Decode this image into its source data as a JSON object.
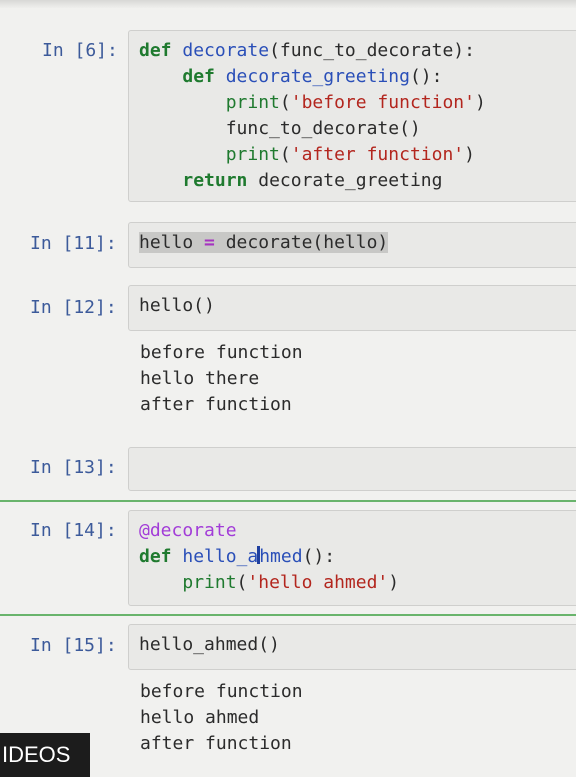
{
  "cells": [
    {
      "prompt": "In [6]:",
      "lines": [
        {
          "tokens": [
            {
              "t": "def",
              "c": "kw"
            },
            {
              "t": " ",
              "c": "txt"
            },
            {
              "t": "decorate",
              "c": "fn"
            },
            {
              "t": "(func_to_decorate):",
              "c": "txt"
            }
          ]
        },
        {
          "tokens": [
            {
              "t": "    ",
              "c": "txt"
            },
            {
              "t": "def",
              "c": "kw"
            },
            {
              "t": " ",
              "c": "txt"
            },
            {
              "t": "decorate_greeting",
              "c": "fn"
            },
            {
              "t": "():",
              "c": "txt"
            }
          ]
        },
        {
          "tokens": [
            {
              "t": "        ",
              "c": "txt"
            },
            {
              "t": "print",
              "c": "bi"
            },
            {
              "t": "(",
              "c": "txt"
            },
            {
              "t": "'before function'",
              "c": "str"
            },
            {
              "t": ")",
              "c": "txt"
            }
          ]
        },
        {
          "tokens": [
            {
              "t": "        func_to_decorate()",
              "c": "txt"
            }
          ]
        },
        {
          "tokens": [
            {
              "t": "        ",
              "c": "txt"
            },
            {
              "t": "print",
              "c": "bi"
            },
            {
              "t": "(",
              "c": "txt"
            },
            {
              "t": "'after function'",
              "c": "str"
            },
            {
              "t": ")",
              "c": "txt"
            }
          ]
        },
        {
          "tokens": [
            {
              "t": "    ",
              "c": "txt"
            },
            {
              "t": "return",
              "c": "kw"
            },
            {
              "t": " decorate_greeting",
              "c": "txt"
            }
          ]
        }
      ],
      "output": []
    },
    {
      "prompt": "In [11]:",
      "lines": [
        {
          "tokens": [
            {
              "t": "hello ",
              "c": "txt sel-bg"
            },
            {
              "t": "=",
              "c": "op sel-bg"
            },
            {
              "t": " decorate(hello)",
              "c": "txt sel-bg"
            }
          ]
        }
      ],
      "output": []
    },
    {
      "prompt": "In [12]:",
      "lines": [
        {
          "tokens": [
            {
              "t": "hello()",
              "c": "txt"
            }
          ]
        }
      ],
      "output": [
        "before function",
        "hello there",
        "after function"
      ]
    },
    {
      "prompt": "In [13]:",
      "lines": [],
      "output": []
    },
    {
      "prompt": "In [14]:",
      "lines": [
        {
          "tokens": [
            {
              "t": "@decorate",
              "c": "deco"
            }
          ]
        },
        {
          "tokens": [
            {
              "t": "def",
              "c": "kw"
            },
            {
              "t": " ",
              "c": "txt"
            },
            {
              "t": "hello_ahmed",
              "c": "fn",
              "cursor_after": 7
            },
            {
              "t": "():",
              "c": "txt"
            }
          ]
        },
        {
          "tokens": [
            {
              "t": "    ",
              "c": "txt"
            },
            {
              "t": "print",
              "c": "bi"
            },
            {
              "t": "(",
              "c": "txt"
            },
            {
              "t": "'hello ahmed'",
              "c": "str"
            },
            {
              "t": ")",
              "c": "txt"
            }
          ]
        }
      ],
      "output": []
    },
    {
      "prompt": "In [15]:",
      "lines": [
        {
          "tokens": [
            {
              "t": "hello_ahmed()",
              "c": "txt"
            }
          ]
        }
      ],
      "output": [
        "before function",
        "hello ahmed",
        "after function"
      ]
    }
  ],
  "overlay_badge": "IDEOS"
}
